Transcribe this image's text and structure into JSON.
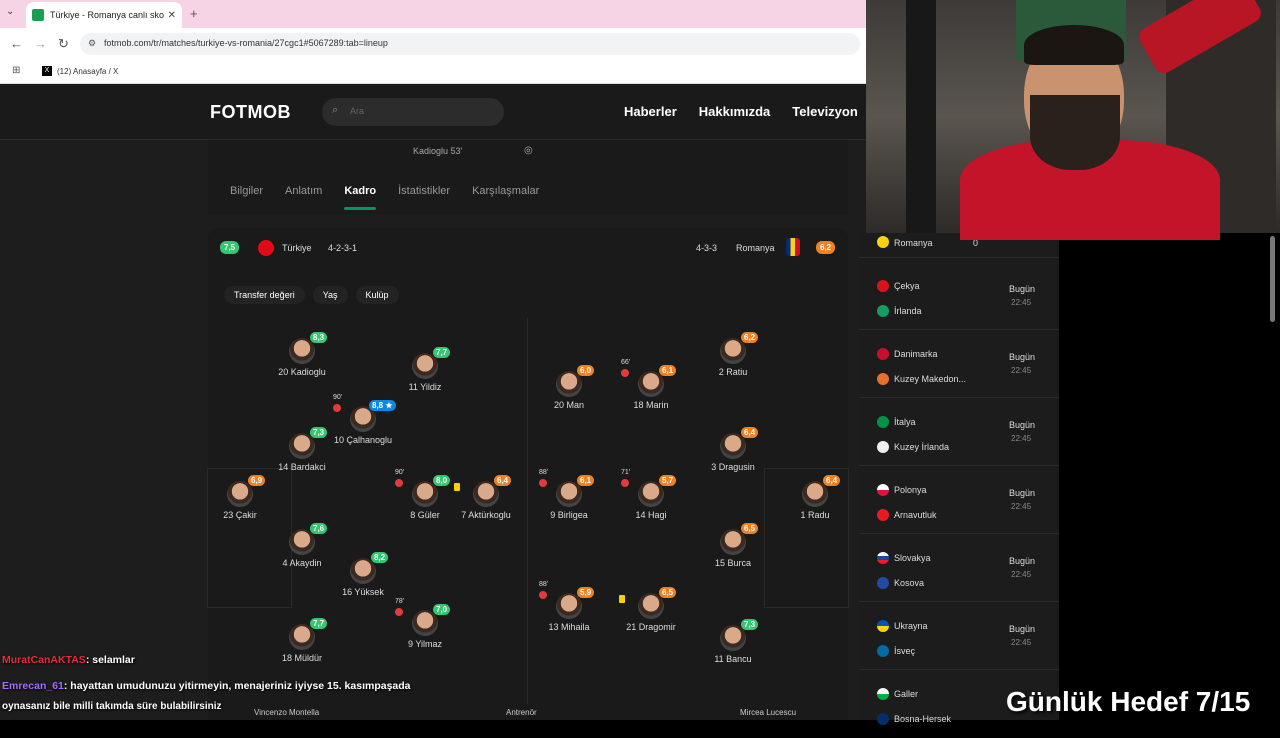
{
  "browser": {
    "tab_title": "Türkiye - Romanya canlı skor, tr",
    "url": "fotmob.com/tr/matches/turkiye-vs-romania/27cgc1#5067289:tab=lineup",
    "bookmark": "(12) Anasayfa / X",
    "bookmark_icon": "X"
  },
  "site": {
    "logo": "FOTMOB",
    "search_placeholder": "Ara",
    "nav": [
      "Haberler",
      "Hakkımızda",
      "Televizyon"
    ],
    "goal_line": "Kadioglu 53'",
    "tabs": [
      "Bilgiler",
      "Anlatım",
      "Kadro",
      "İstatistikler",
      "Karşılaşmalar"
    ],
    "active_tab": "Kadro"
  },
  "lineup": {
    "home": {
      "name": "Türkiye",
      "rating": "7,5",
      "formation": "4-2-3-1"
    },
    "away": {
      "name": "Romanya",
      "rating": "6,2",
      "formation": "4-3-3"
    },
    "filters": [
      "Transfer değeri",
      "Yaş",
      "Kulüp"
    ],
    "players": {
      "p1": {
        "name": "20 Kadioglu",
        "rating": "8,3"
      },
      "p2": {
        "name": "11 Yildiz",
        "rating": "7,7"
      },
      "p3": {
        "name": "10 Çalhanoglu",
        "rating": "8,8 ★",
        "sub": "90'"
      },
      "p4": {
        "name": "14 Bardakci",
        "rating": "7,3"
      },
      "p5": {
        "name": "23 Çakir",
        "rating": "6,9"
      },
      "p6": {
        "name": "8 Güler",
        "rating": "8,0",
        "sub": "90'"
      },
      "p7": {
        "name": "7 Aktürkoglu",
        "rating": "6,4"
      },
      "p8": {
        "name": "4 Akaydin",
        "rating": "7,6"
      },
      "p9": {
        "name": "16 Yüksek",
        "rating": "8,2"
      },
      "p10": {
        "name": "9 Yilmaz",
        "rating": "7,0",
        "sub": "78'"
      },
      "p11": {
        "name": "18 Müldür",
        "rating": "7,7"
      },
      "r1": {
        "name": "20 Man",
        "rating": "6,0"
      },
      "r2": {
        "name": "18 Marin",
        "rating": "6,1",
        "sub": "66'"
      },
      "r3": {
        "name": "2 Ratiu",
        "rating": "6,2"
      },
      "r4": {
        "name": "3 Dragusin",
        "rating": "6,4"
      },
      "r5": {
        "name": "9 Birligea",
        "rating": "6,1",
        "sub": "88'"
      },
      "r6": {
        "name": "14 Hagi",
        "rating": "5,7",
        "sub": "71'"
      },
      "r7": {
        "name": "1 Radu",
        "rating": "6,4"
      },
      "r8": {
        "name": "15 Burca",
        "rating": "6,5"
      },
      "r9": {
        "name": "13 Mihaila",
        "rating": "5,9",
        "sub": "88'"
      },
      "r10": {
        "name": "21 Dragomir",
        "rating": "6,5"
      },
      "r11": {
        "name": "11 Bancu",
        "rating": "7,3"
      }
    },
    "bench_row": [
      "Vincenzo Montella",
      "Antrenör",
      "Mircea Lucescu"
    ]
  },
  "sidebar": {
    "first": {
      "team": "Romanya",
      "score": "0"
    },
    "matches": [
      {
        "home": "Çekya",
        "away": "İrlanda",
        "day": "Bugün",
        "time": "22:45"
      },
      {
        "home": "Danimarka",
        "away": "Kuzey Makedon...",
        "day": "Bugün",
        "time": "22:45"
      },
      {
        "home": "İtalya",
        "away": "Kuzey İrlanda",
        "day": "Bugün",
        "time": "22:45"
      },
      {
        "home": "Polonya",
        "away": "Arnavutluk",
        "day": "Bugün",
        "time": "22:45"
      },
      {
        "home": "Slovakya",
        "away": "Kosova",
        "day": "Bugün",
        "time": "22:45"
      },
      {
        "home": "Ukrayna",
        "away": "İsveç",
        "day": "Bugün",
        "time": "22:45"
      },
      {
        "home": "Galler",
        "away": "Bosna-Hersek",
        "day": "",
        "time": ""
      }
    ]
  },
  "chat": [
    {
      "user": "MuratCanAKTAS",
      "text": ": selamlar",
      "color": "#e0303a"
    },
    {
      "user": "Emrecan_61",
      "text": ": hayattan umudunuzu yitirmeyin, menajeriniz iyiyse 15. kasımpaşada",
      "color": "#a36bff"
    },
    {
      "user": "",
      "text": "oynasanız bile milli takımda süre bulabilirsiniz",
      "color": "#fff"
    }
  ],
  "overlay": {
    "goal": "Günlük Hedef 7/15"
  }
}
